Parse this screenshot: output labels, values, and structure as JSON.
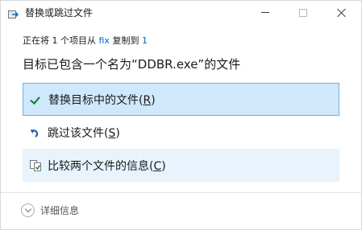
{
  "window": {
    "title": "替换或跳过文件",
    "icon": "file-move-icon",
    "controls": {
      "minimize": "minimize",
      "maximize": "maximize",
      "close": "close"
    }
  },
  "progress": {
    "prefix": "正在将 1 个项目从 ",
    "source": "fix",
    "middle": " 复制到 ",
    "destination": "1"
  },
  "heading": "目标已包含一个名为“DDBR.exe”的文件",
  "options": [
    {
      "label": "替换目标中的文件(",
      "accel": "R",
      "suffix": ")",
      "icon": "check-icon",
      "state": "selected"
    },
    {
      "label": "跳过该文件(",
      "accel": "S",
      "suffix": ")",
      "icon": "skip-arrow-icon",
      "state": "normal"
    },
    {
      "label": "比较两个文件的信息(",
      "accel": "C",
      "suffix": ")",
      "icon": "compare-files-icon",
      "state": "hover"
    }
  ],
  "details": {
    "label": "详细信息",
    "icon": "chevron-down-icon"
  },
  "colors": {
    "accent": "#0066cc",
    "selected_bg": "#cfe8fc",
    "selected_border": "#7aaee0",
    "hover_bg": "#e8f3fd"
  }
}
